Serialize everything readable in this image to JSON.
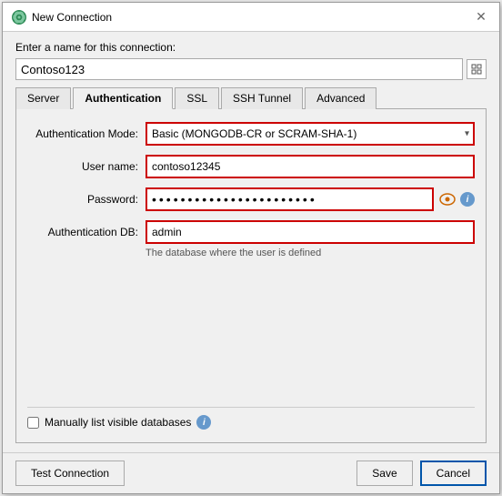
{
  "title": "New Connection",
  "app_icon": "M",
  "close_icon": "✕",
  "connection_name_label": "Enter a name for this connection:",
  "connection_name_value": "Contoso123",
  "grid_icon": "⊞",
  "tabs": [
    {
      "label": "Server",
      "active": false
    },
    {
      "label": "Authentication",
      "active": true
    },
    {
      "label": "SSL",
      "active": false
    },
    {
      "label": "SSH Tunnel",
      "active": false
    },
    {
      "label": "Advanced",
      "active": false
    }
  ],
  "auth": {
    "mode_label": "Authentication Mode:",
    "mode_value": "Basic (MONGODB-CR or SCRAM-SHA-1)",
    "username_label": "User name:",
    "username_value": "contoso12345",
    "password_label": "Password:",
    "password_value": "••••••••••••••••••••••••••••••••••••••••••••",
    "authdb_label": "Authentication DB:",
    "authdb_value": "admin",
    "authdb_hint": "The database where the user is defined",
    "eye_icon": "👁",
    "info_icon": "i"
  },
  "checkbox": {
    "label": "Manually list visible databases",
    "checked": false
  },
  "footer": {
    "test_label": "Test Connection",
    "save_label": "Save",
    "cancel_label": "Cancel"
  }
}
